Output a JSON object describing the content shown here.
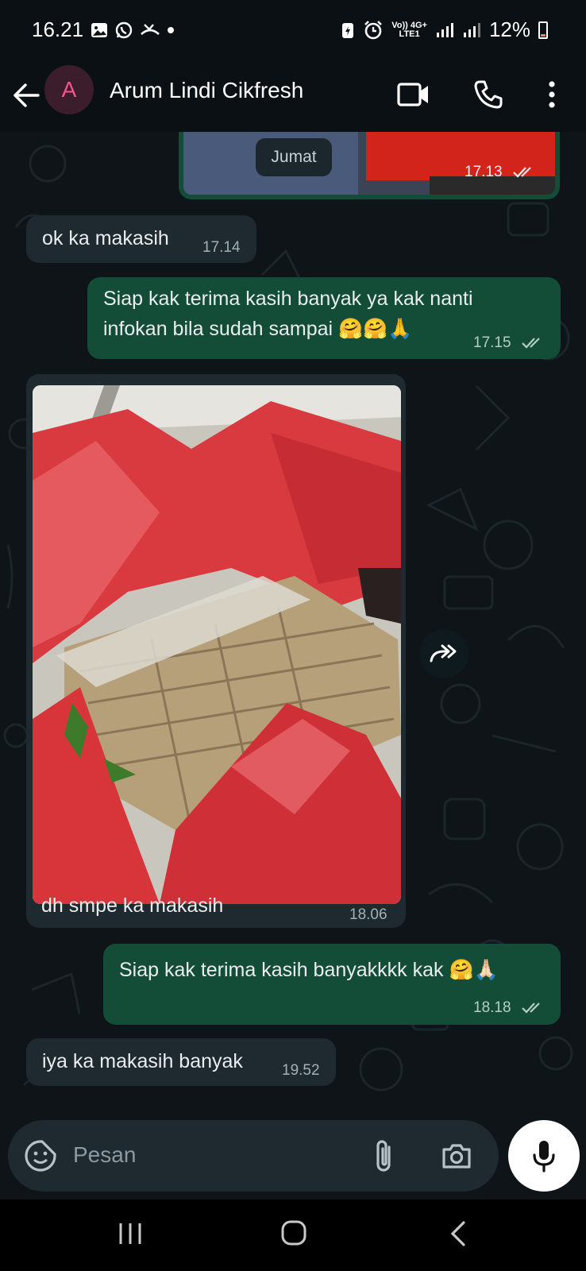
{
  "status_bar": {
    "time": "16.21",
    "battery": "12%",
    "network_top": "Vo)) 4G+",
    "network_bottom": "LTE1"
  },
  "header": {
    "avatar_letter": "A",
    "contact_name": "Arum Lindi Cikfresh"
  },
  "chat": {
    "date_chip": "Jumat",
    "messages": [
      {
        "text": "",
        "time": "17.13",
        "direction": "out"
      },
      {
        "text": "ok ka makasih",
        "time": "17.14",
        "direction": "in"
      },
      {
        "text_line1": "Siap kak terima kasih banyak ya kak nanti",
        "text_line2": "infokan bila sudah sampai 🤗🤗🙏",
        "time": "17.15",
        "direction": "out"
      },
      {
        "caption": "dh smpe ka makasih",
        "time": "18.06",
        "direction": "in"
      },
      {
        "text": "Siap kak terima kasih banyakkkk kak 🤗🙏🏻",
        "time": "18.18",
        "direction": "out"
      },
      {
        "text": "iya ka makasih banyak",
        "time": "19.52",
        "direction": "in"
      }
    ]
  },
  "input": {
    "placeholder": "Pesan"
  },
  "colors": {
    "outgoing_bubble": "#134d37",
    "incoming_bubble": "#1f2a30",
    "avatar_text": "#f3558e"
  }
}
